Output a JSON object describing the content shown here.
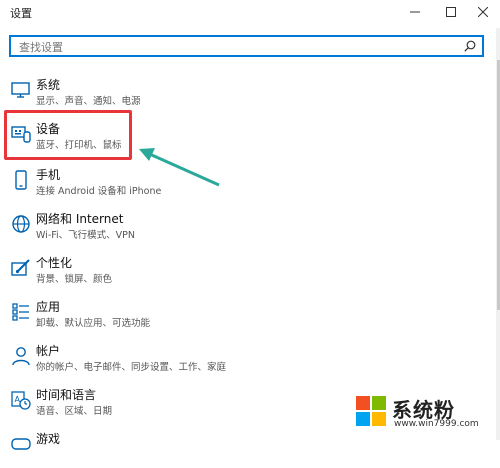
{
  "window": {
    "title": "设置",
    "minimize_icon": "minimize-icon",
    "maximize_icon": "maximize-icon",
    "close_icon": "close-icon"
  },
  "search": {
    "placeholder": "查找设置",
    "value": "",
    "icon": "search-icon"
  },
  "categories": [
    {
      "label": "系统",
      "sub": "显示、声音、通知、电源",
      "icon": "monitor-icon"
    },
    {
      "label": "设备",
      "sub": "蓝牙、打印机、鼠标",
      "icon": "keyboard-icon"
    },
    {
      "label": "手机",
      "sub": "连接 Android 设备和 iPhone",
      "icon": "phone-icon"
    },
    {
      "label": "网络和 Internet",
      "sub": "Wi-Fi、飞行模式、VPN",
      "icon": "globe-icon"
    },
    {
      "label": "个性化",
      "sub": "背景、锁屏、颜色",
      "icon": "paintbrush-icon"
    },
    {
      "label": "应用",
      "sub": "卸载、默认应用、可选功能",
      "icon": "apps-icon"
    },
    {
      "label": "帐户",
      "sub": "你的帐户、电子邮件、同步设置、工作、家庭",
      "icon": "person-icon"
    },
    {
      "label": "时间和语言",
      "sub": "语音、区域、日期",
      "icon": "time-language-icon"
    },
    {
      "label": "游戏",
      "sub": "",
      "icon": "gamepad-icon"
    }
  ],
  "colors": {
    "accent": "#0078d7",
    "highlight": "#e8353b",
    "arrow": "#2aa99a"
  },
  "watermark": {
    "text": "系统粉",
    "url": "www.win7999.com"
  }
}
